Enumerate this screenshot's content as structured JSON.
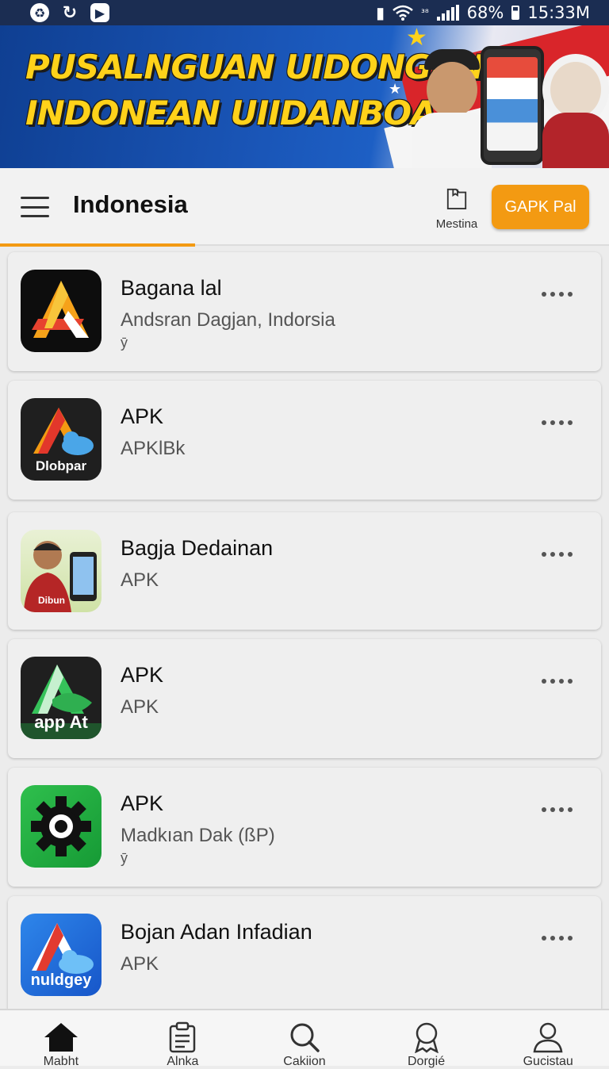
{
  "status_bar": {
    "right_small": "³⁸",
    "battery": "68%",
    "time": "15:33M"
  },
  "banner": {
    "line1": "PUSALNGUAN UIDONGAN",
    "line2": "INDONEAN UIIDANBOA!"
  },
  "header": {
    "title": "Indonesia",
    "doc_action_label": "Mestina",
    "primary_button": "GAPK Pal"
  },
  "apps": [
    {
      "name": "Bagana lal",
      "subtitle": "Andsran Dagjan,  Indorsia",
      "extra": "ȳ",
      "icon_text": ""
    },
    {
      "name": "APK",
      "subtitle": "APKlBk",
      "extra": "",
      "icon_text": "Dlobpar"
    },
    {
      "name": "Bagja Dedainan",
      "subtitle": "APK",
      "extra": "",
      "icon_text": "Dibun"
    },
    {
      "name": "APK",
      "subtitle": "APK",
      "extra": "",
      "icon_text": "app At"
    },
    {
      "name": "APK",
      "subtitle": "Madkıan Dak (ßP)",
      "extra": "ȳ",
      "icon_text": ""
    },
    {
      "name": "Bojan Adan Infadian",
      "subtitle": "APK",
      "extra": "",
      "icon_text": "nuldgey"
    }
  ],
  "bottom_nav": [
    {
      "label": "Mabht",
      "icon": "home-icon"
    },
    {
      "label": "Alnkа",
      "icon": "clipboard-icon"
    },
    {
      "label": "Cakiion",
      "icon": "search-icon"
    },
    {
      "label": "Dorgié",
      "icon": "badge-icon"
    },
    {
      "label": "Gucistau",
      "icon": "profile-icon"
    }
  ],
  "colors": {
    "accent": "#f39a12",
    "status_bar": "#1b2d52",
    "banner_blue": "#1a56b8",
    "banner_text": "#ffd21a"
  }
}
